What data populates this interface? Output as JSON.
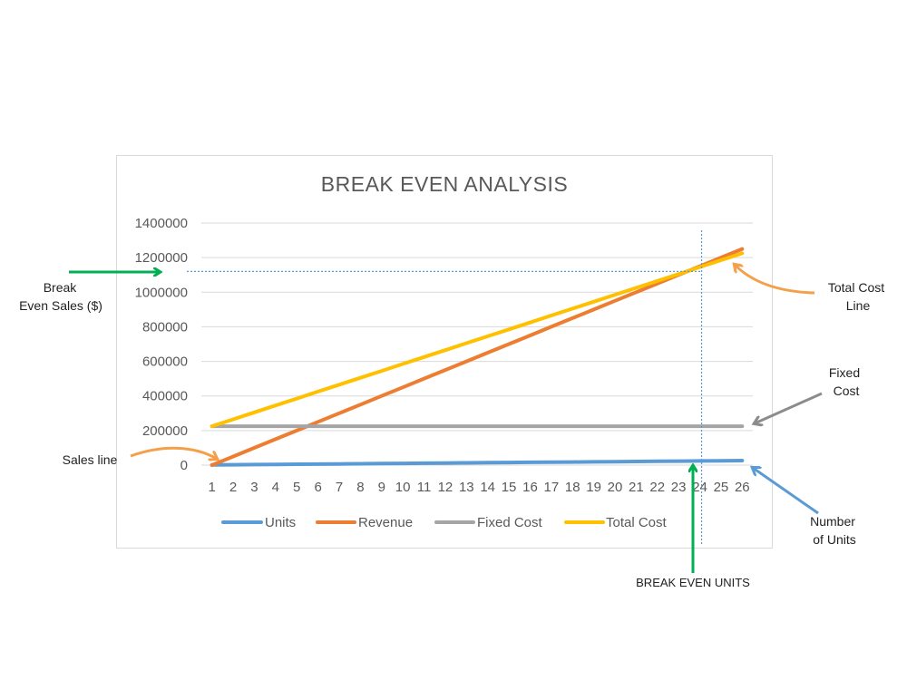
{
  "chart_data": {
    "type": "line",
    "title": "BREAK EVEN ANALYSIS",
    "xlabel": "",
    "ylabel": "",
    "x": [
      1,
      2,
      3,
      4,
      5,
      6,
      7,
      8,
      9,
      10,
      11,
      12,
      13,
      14,
      15,
      16,
      17,
      18,
      19,
      20,
      21,
      22,
      23,
      24,
      25,
      26
    ],
    "ylim": [
      0,
      1400000
    ],
    "yticks": [
      0,
      200000,
      400000,
      600000,
      800000,
      1000000,
      1200000,
      1400000
    ],
    "grid": true,
    "legend_position": "bottom",
    "series": [
      {
        "name": "Units",
        "color": "#5b9bd5",
        "values": [
          1000,
          2000,
          3000,
          4000,
          5000,
          6000,
          7000,
          8000,
          9000,
          10000,
          11000,
          12000,
          13000,
          14000,
          15000,
          16000,
          17000,
          18000,
          19000,
          20000,
          21000,
          22000,
          23000,
          24000,
          25000,
          26000
        ]
      },
      {
        "name": "Revenue",
        "color": "#ed7d31",
        "start": 0,
        "end": 1250000
      },
      {
        "name": "Fixed Cost",
        "color": "#a5a5a5",
        "start": 225000,
        "end": 225000
      },
      {
        "name": "Total Cost",
        "color": "#ffc000",
        "start": 225000,
        "end": 1225000
      }
    ],
    "break_even": {
      "x": 24,
      "y": 1120000
    }
  },
  "annotations": {
    "break_even_sales_line1": "Break",
    "break_even_sales_line2": "Even Sales ($)",
    "total_cost_line1": "Total Cost",
    "total_cost_line2": "Line",
    "fixed_cost_line1": "Fixed",
    "fixed_cost_line2": "Cost",
    "sales_line": "Sales line",
    "number_units_line1": "Number",
    "number_units_line2": "of Units",
    "break_even_units": "BREAK EVEN UNITS"
  },
  "colors": {
    "green_arrow": "#00b050",
    "orange_arrow": "#f4a04a",
    "gray_arrow": "#8c8c8c",
    "blue_arrow": "#5b9bd5",
    "grid": "#d9d9d9",
    "dotted": "#5b9bd5"
  }
}
